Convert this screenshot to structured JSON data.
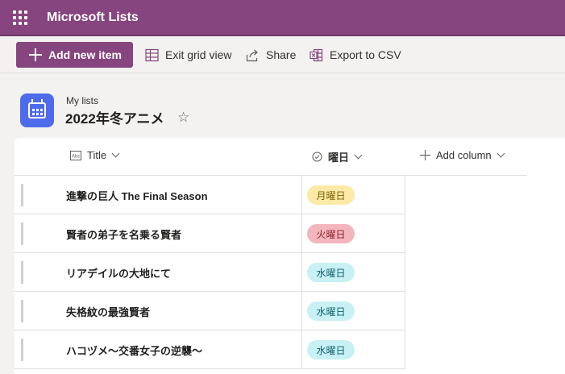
{
  "suitebar": {
    "app_title": "Microsoft Lists",
    "waffle_icon": "waffle-icon",
    "bg": "#86457e"
  },
  "command_bar": {
    "add_new_item": "Add new item",
    "exit_grid_view": "Exit grid view",
    "share": "Share",
    "export_csv": "Export to CSV"
  },
  "header": {
    "breadcrumb": "My lists",
    "title": "2022年冬アニメ"
  },
  "grid": {
    "columns": {
      "title": "Title",
      "day": "曜日",
      "add_column": "Add column"
    },
    "rows": [
      {
        "title": "進撃の巨人 The Final Season",
        "day": "月曜日",
        "day_bg": "#fdeaa6",
        "day_fg": "#7a5d00"
      },
      {
        "title": "賢者の弟子を名乗る賢者",
        "day": "火曜日",
        "day_bg": "#f4b6bd",
        "day_fg": "#8a1f2b"
      },
      {
        "title": "リアデイルの大地にて",
        "day": "水曜日",
        "day_bg": "#c8f1f5",
        "day_fg": "#0b5f6b"
      },
      {
        "title": "失格紋の最強賢者",
        "day": "水曜日",
        "day_bg": "#c8f1f5",
        "day_fg": "#0b5f6b"
      },
      {
        "title": "ハコヅメ～交番女子の逆襲～",
        "day": "水曜日",
        "day_bg": "#c8f1f5",
        "day_fg": "#0b5f6b"
      }
    ]
  }
}
